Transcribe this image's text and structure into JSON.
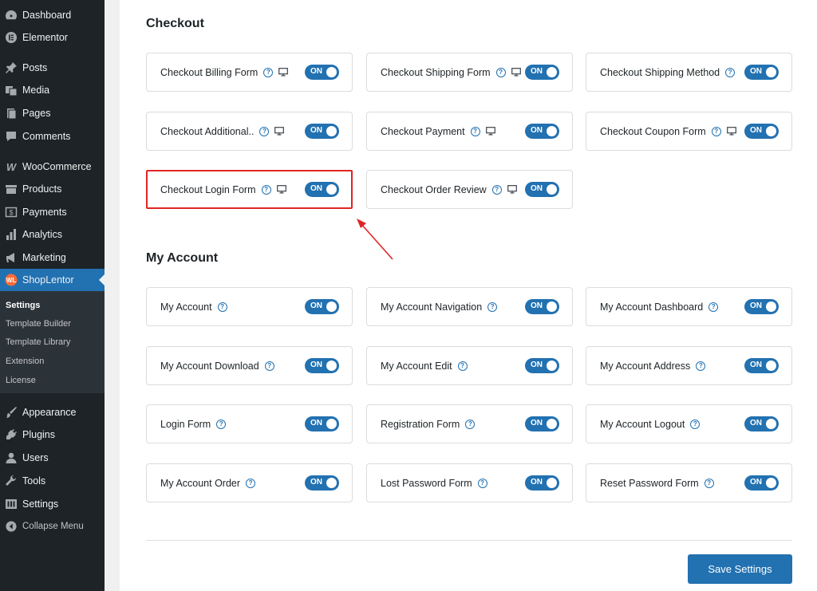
{
  "sidebar": {
    "items": [
      {
        "label": "Dashboard",
        "icon": "dashboard-icon"
      },
      {
        "label": "Elementor",
        "icon": "elementor-icon"
      },
      {
        "label": "Posts",
        "icon": "pin-icon"
      },
      {
        "label": "Media",
        "icon": "media-icon"
      },
      {
        "label": "Pages",
        "icon": "pages-icon"
      },
      {
        "label": "Comments",
        "icon": "comment-icon"
      },
      {
        "label": "WooCommerce",
        "icon": "woocommerce-icon"
      },
      {
        "label": "Products",
        "icon": "products-icon"
      },
      {
        "label": "Payments",
        "icon": "payments-icon"
      },
      {
        "label": "Analytics",
        "icon": "analytics-icon"
      },
      {
        "label": "Marketing",
        "icon": "megaphone-icon"
      },
      {
        "label": "ShopLentor",
        "icon": "shoplentor-icon"
      },
      {
        "label": "Appearance",
        "icon": "brush-icon"
      },
      {
        "label": "Plugins",
        "icon": "plugin-icon"
      },
      {
        "label": "Users",
        "icon": "user-icon"
      },
      {
        "label": "Tools",
        "icon": "wrench-icon"
      },
      {
        "label": "Settings",
        "icon": "settings-icon"
      },
      {
        "label": "Collapse Menu",
        "icon": "collapse-icon"
      }
    ],
    "submenu": [
      "Settings",
      "Template Builder",
      "Template Library",
      "Extension",
      "License"
    ]
  },
  "sections": {
    "checkout": {
      "title": "Checkout",
      "cards": [
        {
          "label": "Checkout Billing Form",
          "toggle": "ON"
        },
        {
          "label": "Checkout Shipping Form",
          "toggle": "ON"
        },
        {
          "label": "Checkout Shipping Method",
          "toggle": "ON"
        },
        {
          "label": "Checkout Additional..",
          "toggle": "ON"
        },
        {
          "label": "Checkout Payment",
          "toggle": "ON"
        },
        {
          "label": "Checkout Coupon Form",
          "toggle": "ON"
        },
        {
          "label": "Checkout Login Form",
          "toggle": "ON"
        },
        {
          "label": "Checkout Order Review",
          "toggle": "ON"
        }
      ]
    },
    "my_account": {
      "title": "My Account",
      "cards": [
        {
          "label": "My Account",
          "toggle": "ON"
        },
        {
          "label": "My Account Navigation",
          "toggle": "ON"
        },
        {
          "label": "My Account Dashboard",
          "toggle": "ON"
        },
        {
          "label": "My Account Download",
          "toggle": "ON"
        },
        {
          "label": "My Account Edit",
          "toggle": "ON"
        },
        {
          "label": "My Account Address",
          "toggle": "ON"
        },
        {
          "label": "Login Form",
          "toggle": "ON"
        },
        {
          "label": "Registration Form",
          "toggle": "ON"
        },
        {
          "label": "My Account Logout",
          "toggle": "ON"
        },
        {
          "label": "My Account Order",
          "toggle": "ON"
        },
        {
          "label": "Lost Password Form",
          "toggle": "ON"
        },
        {
          "label": "Reset Password Form",
          "toggle": "ON"
        }
      ]
    }
  },
  "save_button": {
    "label": "Save Settings"
  },
  "colors": {
    "accent": "#2271b1",
    "sidebar_bg": "#1d2327",
    "highlight": "#e02424"
  }
}
